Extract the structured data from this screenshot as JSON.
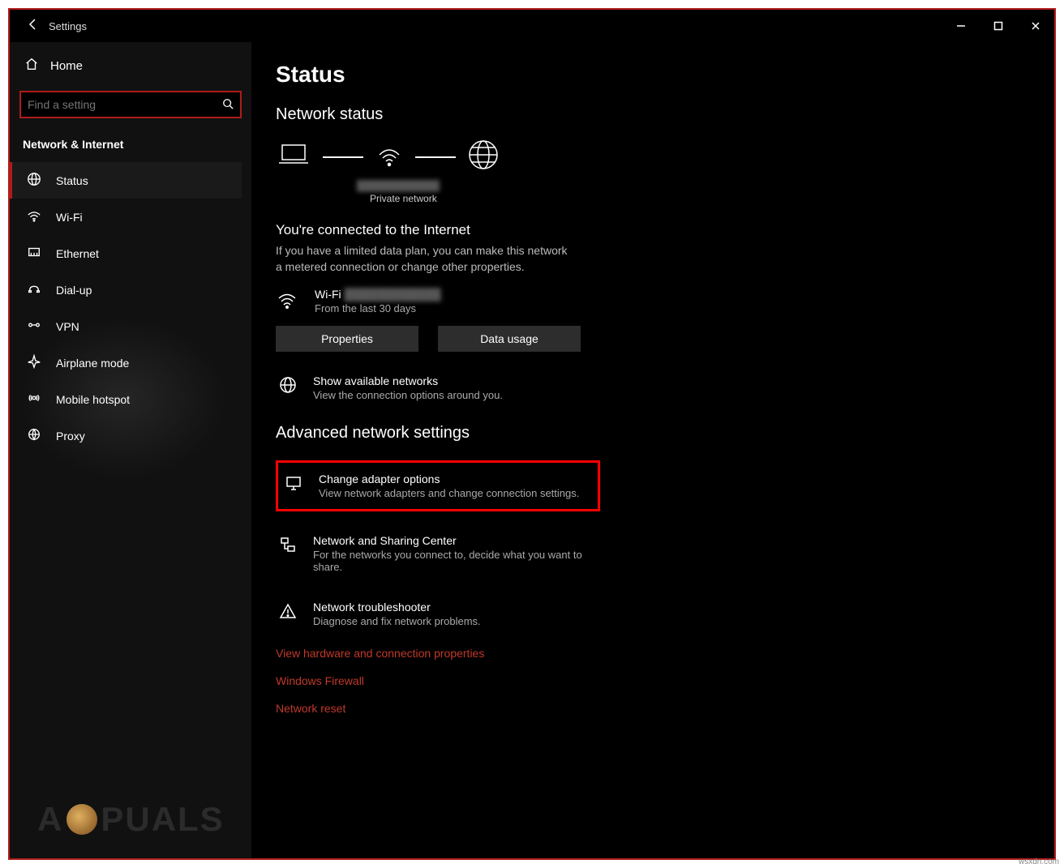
{
  "window": {
    "title": "Settings"
  },
  "sidebar": {
    "home": "Home",
    "search_placeholder": "Find a setting",
    "category": "Network & Internet",
    "items": [
      {
        "label": "Status",
        "icon": "status"
      },
      {
        "label": "Wi-Fi",
        "icon": "wifi"
      },
      {
        "label": "Ethernet",
        "icon": "ethernet"
      },
      {
        "label": "Dial-up",
        "icon": "dialup"
      },
      {
        "label": "VPN",
        "icon": "vpn"
      },
      {
        "label": "Airplane mode",
        "icon": "airplane"
      },
      {
        "label": "Mobile hotspot",
        "icon": "hotspot"
      },
      {
        "label": "Proxy",
        "icon": "proxy"
      }
    ]
  },
  "main": {
    "page_title": "Status",
    "network_status": "Network status",
    "network_type": "Private network",
    "connected_heading": "You're connected to the Internet",
    "connected_sub": "If you have a limited data plan, you can make this network a metered connection or change other properties.",
    "conn": {
      "name": "Wi-Fi",
      "since": "From the last 30 days"
    },
    "buttons": {
      "properties": "Properties",
      "data_usage": "Data usage"
    },
    "show_available": {
      "title": "Show available networks",
      "desc": "View the connection options around you."
    },
    "advanced_heading": "Advanced network settings",
    "change_adapter": {
      "title": "Change adapter options",
      "desc": "View network adapters and change connection settings."
    },
    "sharing_center": {
      "title": "Network and Sharing Center",
      "desc": "For the networks you connect to, decide what you want to share."
    },
    "troubleshooter": {
      "title": "Network troubleshooter",
      "desc": "Diagnose and fix network problems."
    },
    "links": {
      "hardware": "View hardware and connection properties",
      "firewall": "Windows Firewall",
      "reset": "Network reset"
    }
  },
  "watermark": "A  PUALS",
  "corner": "wsxdn.com"
}
